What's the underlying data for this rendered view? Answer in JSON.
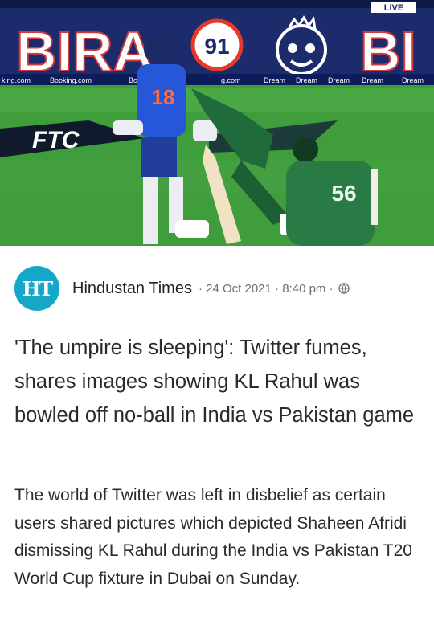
{
  "hero": {
    "banner_left": "BIRA",
    "banner_badge": "91",
    "banner_right": "BI",
    "live_label": "LIVE",
    "ad_strip_left": [
      "king.com",
      "Booking.com",
      "Bo",
      "g.com"
    ],
    "ad_strip_right": [
      "Dream",
      "Dream",
      "Dream",
      "Dream",
      "Dream"
    ],
    "player_left_number": "18",
    "player_right_number": "56",
    "field_logo": "FTC"
  },
  "source": {
    "logo_text": "HT",
    "publisher": "Hindustan Times",
    "date": "24 Oct 2021",
    "time": "8:40 pm",
    "separator": "·"
  },
  "article": {
    "headline": "'The umpire is sleeping': Twitter fumes, shares images showing KL Rahul was bowled off no-ball in India vs Pakistan game",
    "summary": "The world of Twitter was left in disbelief as certain users shared pictures which depicted Shaheen Afridi dismissing KL Rahul during the India vs Pakistan T20 World Cup fixture in Dubai on Sunday."
  }
}
